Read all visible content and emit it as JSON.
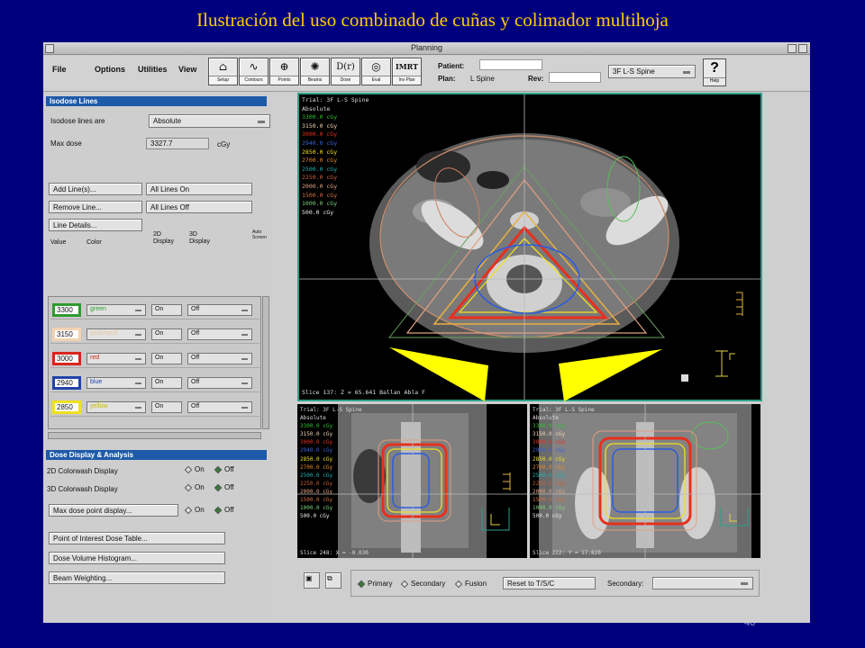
{
  "slide_title": "Ilustración del uso combinado de cuñas y colimador multihoja",
  "slide_number": "40",
  "window": {
    "title": "Planning"
  },
  "menus": [
    "File",
    "Options",
    "Utilities",
    "View"
  ],
  "tools": [
    {
      "label": "Setup",
      "icon": "setup-icon",
      "glyph": "⌂"
    },
    {
      "label": "Contours",
      "icon": "contours-icon",
      "glyph": "∿"
    },
    {
      "label": "Points",
      "icon": "points-icon",
      "glyph": "⊕"
    },
    {
      "label": "Beams",
      "icon": "beams-icon",
      "glyph": "✺"
    },
    {
      "label": "Dose",
      "icon": "dose-icon",
      "glyph": "D(r)"
    },
    {
      "label": "Eval",
      "icon": "eval-icon",
      "glyph": "◎"
    },
    {
      "label": "Inv Plan",
      "icon": "imrt-icon",
      "glyph": "IMRT"
    }
  ],
  "patient": {
    "patient_label": "Patient:",
    "plan_label": "Plan:",
    "plan_value": "L Spine",
    "rev_label": "Rev:"
  },
  "trial_select": "3F L-S Spine",
  "help_label": "Help",
  "isodose": {
    "header": "Isodose Lines",
    "lines_are_label": "Isodose lines are",
    "lines_are_value": "Absolute",
    "max_dose_label": "Max dose",
    "max_dose_value": "3327.7",
    "max_dose_unit": "cGy",
    "buttons": {
      "add": "Add Line(s)...",
      "all_on": "All Lines On",
      "remove": "Remove Line...",
      "all_off": "All Lines Off",
      "details": "Line Details..."
    },
    "col_value": "Value",
    "col_color": "Color",
    "col_2d": "2D\nDisplay",
    "col_3d": "3D\nDisplay",
    "auto_label": "Auto\nScreen",
    "rows": [
      {
        "value": "3300",
        "color_name": "green",
        "color": "#2f9b2f",
        "d2": "On",
        "d3": "Off"
      },
      {
        "value": "3150",
        "color_name": "peachpuff",
        "color": "#f2d2b0",
        "d2": "On",
        "d3": "Off"
      },
      {
        "value": "3000",
        "color_name": "red",
        "color": "#d8261c",
        "d2": "On",
        "d3": "Off"
      },
      {
        "value": "2940",
        "color_name": "blue",
        "color": "#2243a8",
        "d2": "On",
        "d3": "Off"
      },
      {
        "value": "2850",
        "color_name": "yellow",
        "color": "#f0e020",
        "d2": "On",
        "d3": "Off"
      }
    ]
  },
  "dose_display": {
    "header": "Dose Display & Analysis",
    "rows": [
      {
        "label": "2D Colorwash Display",
        "on": "On",
        "off": "Off",
        "selected": "off"
      },
      {
        "label": "3D Colorwash Display",
        "on": "On",
        "off": "Off",
        "selected": "off"
      },
      {
        "label": "Max dose point display...",
        "on": "On",
        "off": "Off",
        "selected": "off"
      }
    ],
    "buttons": [
      "Point of Interest Dose Table...",
      "Dose Volume Histogram...",
      "Beam Weighting..."
    ]
  },
  "viewer": {
    "trial_label": "Trial: 3F L-S Spine",
    "mode": "Absolute",
    "legend": [
      {
        "text": "3300.0 cGy",
        "color": "#2fbf2f"
      },
      {
        "text": "3150.0 cGy",
        "color": "#f2d2b0"
      },
      {
        "text": "3000.0 cGy",
        "color": "#e8301e"
      },
      {
        "text": "2940.0 cGy",
        "color": "#3a63d8"
      },
      {
        "text": "2850.0 cGy",
        "color": "#f0e020"
      },
      {
        "text": "2700.0 cGy",
        "color": "#e08a2a"
      },
      {
        "text": "2500.0 cGy",
        "color": "#20b0b0"
      },
      {
        "text": "2250.0 cGy",
        "color": "#c8603a"
      },
      {
        "text": "2000.0 cGy",
        "color": "#e0a080"
      },
      {
        "text": "1500.0 cGy",
        "color": "#d07040"
      },
      {
        "text": "1000.0 cGy",
        "color": "#7fd07f"
      },
      {
        "text": "500.0 cGy",
        "color": "#e8e8e8"
      }
    ],
    "legend_small": [
      {
        "text": "3300.0 cGy",
        "color": "#2fbf2f"
      },
      {
        "text": "3150.0 cGy",
        "color": "#f2d2b0"
      },
      {
        "text": "3000.0 cGy",
        "color": "#e8301e"
      },
      {
        "text": "2940.0 cGy",
        "color": "#3a63d8"
      },
      {
        "text": "2850.0 cGy",
        "color": "#f0e020"
      },
      {
        "text": "2700.0 cGy",
        "color": "#e08a2a"
      },
      {
        "text": "2500.0 cGy",
        "color": "#20b0b0"
      },
      {
        "text": "2250.0 cGy",
        "color": "#c8603a"
      },
      {
        "text": "2000.0 cGy",
        "color": "#e0a080"
      },
      {
        "text": "1500.0 cGy",
        "color": "#d07040"
      },
      {
        "text": "1000.0 cGy",
        "color": "#7fd07f"
      },
      {
        "text": "500.0 cGy",
        "color": "#e8e8e8"
      }
    ],
    "main_slice": "Slice 137: Z = 65.641  Ballan Abla F",
    "sag_slice": "Slice 248: X = -0.030",
    "cor_slice": "Slice 222: Y = 17.820"
  },
  "bottom": {
    "primary": "Primary",
    "secondary": "Secondary",
    "fusion": "Fusion",
    "reset": "Reset to T/S/C",
    "secondary_label": "Secondary:"
  }
}
